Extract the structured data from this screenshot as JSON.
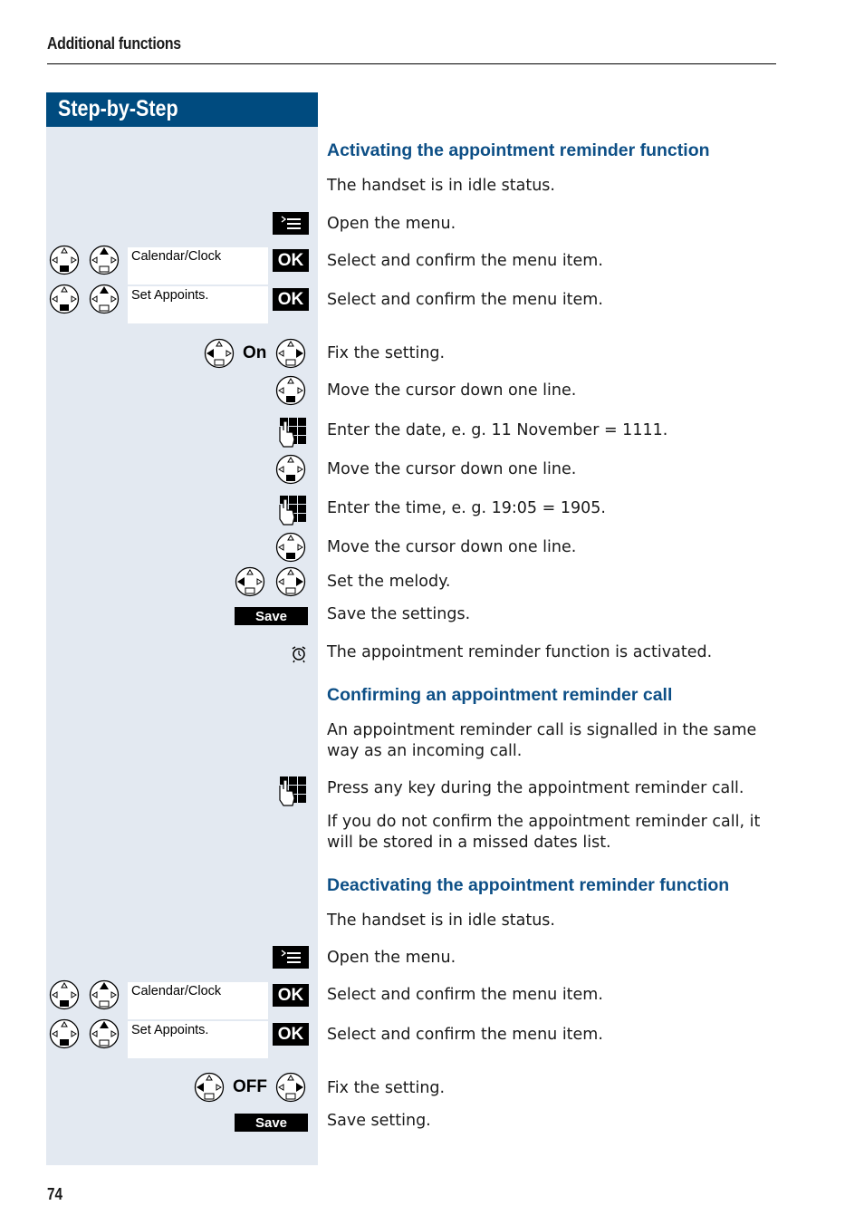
{
  "page": {
    "running_head": "Additional functions",
    "page_number": "74",
    "sidebar_title": "Step-by-Step",
    "accent_color": "#004b7f",
    "heading_color": "#0d4f86",
    "sidebar_bg": "#e3e9f1"
  },
  "sections": [
    {
      "heading": "Activating the appointment reminder function",
      "steps": [
        {
          "keys": [],
          "text": "The handset is in idle status."
        },
        {
          "keys": [
            "menu-key"
          ],
          "text": "Open the menu."
        },
        {
          "keys": [
            "nav-down",
            "nav-up",
            "display:Calendar/Clock",
            "OK"
          ],
          "text": "Select and confirm the menu item."
        },
        {
          "keys": [
            "nav-down",
            "nav-up",
            "display:Set Appoints.",
            "OK"
          ],
          "text": "Select and confirm the menu item."
        },
        {
          "keys": [
            "nav-left",
            "On",
            "nav-right"
          ],
          "text": "Fix the setting."
        },
        {
          "keys": [
            "nav-down"
          ],
          "text": "Move the cursor down one line."
        },
        {
          "keys": [
            "keypad"
          ],
          "text": "Enter the date, e. g. 11 November = 1111."
        },
        {
          "keys": [
            "nav-down"
          ],
          "text": "Move the cursor down one line."
        },
        {
          "keys": [
            "keypad"
          ],
          "text": "Enter the time, e. g. 19:05 = 1905."
        },
        {
          "keys": [
            "nav-down"
          ],
          "text": "Move the cursor down one line."
        },
        {
          "keys": [
            "nav-left",
            "nav-right"
          ],
          "text": "Set the melody."
        },
        {
          "keys": [
            "Save"
          ],
          "text": "Save the settings."
        },
        {
          "keys": [
            "alarm-clock"
          ],
          "text": "The appointment reminder function is activated."
        }
      ]
    },
    {
      "heading": "Confirming an appointment reminder call",
      "steps": [
        {
          "keys": [],
          "text": "An appointment reminder call is signalled in the same way as an incoming call."
        },
        {
          "keys": [
            "keypad"
          ],
          "text": "Press any key during the appointment reminder call."
        },
        {
          "keys": [],
          "text": "If you do not confirm the appointment reminder call, it will be stored in a missed dates list."
        }
      ]
    },
    {
      "heading": "Deactivating the appointment reminder function",
      "steps": [
        {
          "keys": [],
          "text": "The handset is in idle status."
        },
        {
          "keys": [
            "menu-key"
          ],
          "text": "Open the menu."
        },
        {
          "keys": [
            "nav-down",
            "nav-up",
            "display:Calendar/Clock",
            "OK"
          ],
          "text": "Select and confirm the menu item."
        },
        {
          "keys": [
            "nav-down",
            "nav-up",
            "display:Set Appoints.",
            "OK"
          ],
          "text": "Select and confirm the menu item."
        },
        {
          "keys": [
            "nav-left",
            "OFF",
            "nav-right"
          ],
          "text": "Fix the setting."
        },
        {
          "keys": [
            "Save"
          ],
          "text": "Save setting."
        }
      ]
    }
  ],
  "labels": {
    "ok": "OK",
    "save": "Save",
    "on": "On",
    "off": "OFF",
    "calendar_clock": "Calendar/Clock",
    "set_appoints": "Set Appoints."
  }
}
